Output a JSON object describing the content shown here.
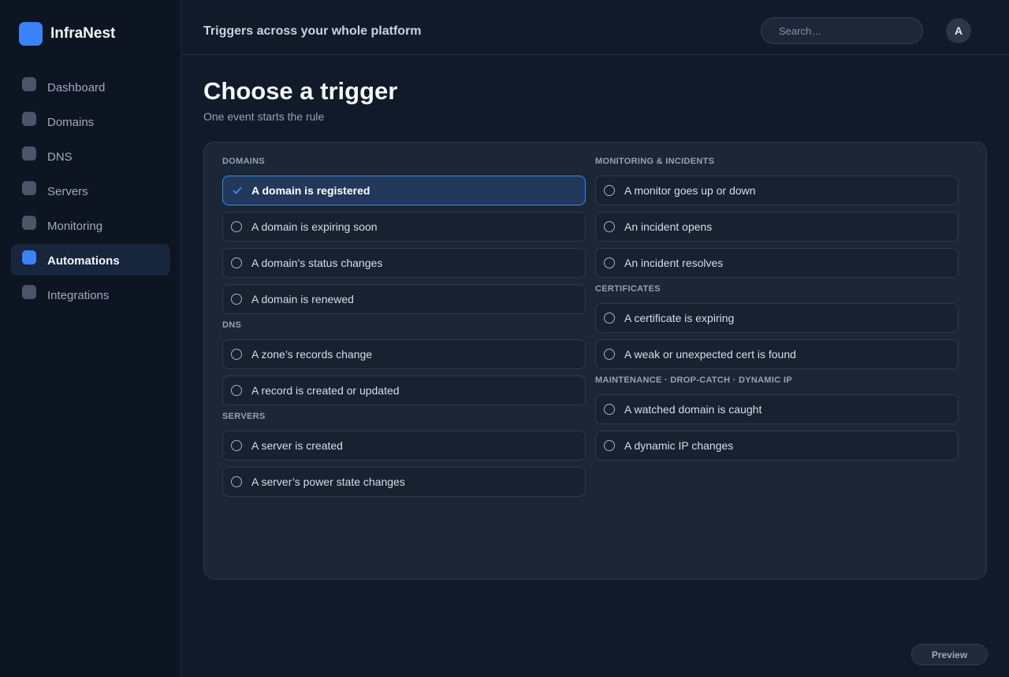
{
  "brand": {
    "name": "InfraNest"
  },
  "sidebar": {
    "items": [
      {
        "label": "Dashboard",
        "active": false
      },
      {
        "label": "Domains",
        "active": false
      },
      {
        "label": "DNS",
        "active": false
      },
      {
        "label": "Servers",
        "active": false
      },
      {
        "label": "Monitoring",
        "active": false
      },
      {
        "label": "Automations",
        "active": true
      },
      {
        "label": "Integrations",
        "active": false
      }
    ]
  },
  "header": {
    "title": "Triggers across your whole platform",
    "search_placeholder": "Search…",
    "avatar_initial": "A"
  },
  "main": {
    "title": "Choose a trigger",
    "subtitle": "One event starts the rule",
    "left_groups": [
      {
        "label": "DOMAINS",
        "options": [
          {
            "label": "A domain is registered",
            "selected": true
          },
          {
            "label": "A domain is expiring soon",
            "selected": false
          },
          {
            "label": "A domain’s status changes",
            "selected": false
          },
          {
            "label": "A domain is renewed",
            "selected": false
          }
        ]
      },
      {
        "label": "DNS",
        "options": [
          {
            "label": "A zone’s records change",
            "selected": false
          },
          {
            "label": "A record is created or updated",
            "selected": false
          }
        ]
      },
      {
        "label": "SERVERS",
        "options": [
          {
            "label": "A server is created",
            "selected": false
          },
          {
            "label": "A server’s power state changes",
            "selected": false
          }
        ]
      }
    ],
    "right_groups": [
      {
        "label": "MONITORING & INCIDENTS",
        "options": [
          {
            "label": "A monitor goes up or down",
            "selected": false
          },
          {
            "label": "An incident opens",
            "selected": false
          },
          {
            "label": "An incident resolves",
            "selected": false
          }
        ]
      },
      {
        "label": "CERTIFICATES",
        "options": [
          {
            "label": "A certificate is expiring",
            "selected": false
          },
          {
            "label": "A weak or unexpected cert is found",
            "selected": false
          }
        ]
      },
      {
        "label": "MAINTENANCE · DROP-CATCH · DYNAMIC IP",
        "options": [
          {
            "label": "A watched domain is caught",
            "selected": false
          },
          {
            "label": "A dynamic IP changes",
            "selected": false
          }
        ]
      }
    ]
  },
  "footer": {
    "preview_label": "Preview"
  },
  "colors": {
    "accent": "#3b82f6",
    "background": "#111a29",
    "sidebar": "#0d1422",
    "panel": "#1c2637"
  },
  "icons": {
    "selected": "check-icon",
    "unselected": "radio-icon",
    "brand": "logo-icon"
  }
}
